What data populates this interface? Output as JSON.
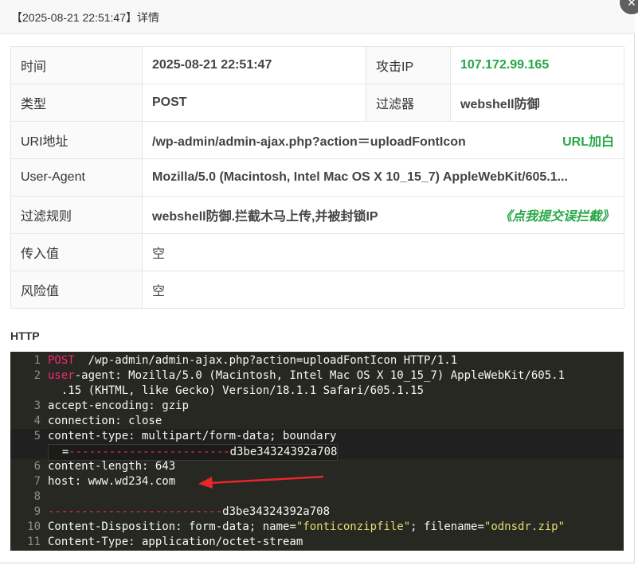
{
  "dialog": {
    "title": "【2025-08-21 22:51:47】详情",
    "close_label": "✕"
  },
  "info_table": {
    "rows": [
      {
        "label": "时间",
        "value": "2025-08-21 22:51:47",
        "label2": "攻击IP",
        "value2": "107.172.99.165"
      },
      {
        "label": "类型",
        "value": "POST",
        "label2": "过滤器",
        "value2": "webshell防御"
      },
      {
        "label": "URI地址",
        "value": "/wp-admin/admin-ajax.php?action＝uploadFontIcon",
        "action": "URL加白"
      },
      {
        "label": "User-Agent",
        "value": "Mozilla/5.0 (Macintosh, Intel Mac OS X 10_15_7) AppleWebKit/605.1..."
      },
      {
        "label": "过滤规则",
        "value": "webshell防御.拦截木马上传,并被封锁IP",
        "action": "《点我提交误拦截》"
      },
      {
        "label": "传入值",
        "value": "空"
      },
      {
        "label": "风险值",
        "value": "空"
      }
    ]
  },
  "http": {
    "label": "HTTP",
    "lines": [
      {
        "n": "1",
        "parts": [
          [
            "kw",
            "POST"
          ],
          [
            "",
            "  /wp-admin/admin-ajax.php?action=uploadFontIcon HTTP/1.1"
          ]
        ]
      },
      {
        "n": "2",
        "parts": [
          [
            "kw",
            "user"
          ],
          [
            "",
            "-agent: Mozilla/5.0 (Macintosh, Intel Mac OS X 10_15_7) AppleWebKit/605.1"
          ]
        ]
      },
      {
        "n": "",
        "parts": [
          [
            "",
            "  .15 (KHTML, like Gecko) Version/18.1.1 Safari/605.1.15"
          ]
        ]
      },
      {
        "n": "3",
        "parts": [
          [
            "",
            "accept-encoding: gzip"
          ]
        ]
      },
      {
        "n": "4",
        "parts": [
          [
            "",
            "connection: close"
          ]
        ]
      },
      {
        "n": "5",
        "parts": [
          [
            "",
            "content-type: multipart/form-data; boundary"
          ]
        ]
      },
      {
        "n": "",
        "parts": [
          [
            "",
            "  ="
          ],
          [
            "kw",
            "------------------------"
          ],
          [
            "",
            "d3be34324392a708"
          ]
        ]
      },
      {
        "n": "6",
        "parts": [
          [
            "",
            "content-length: 643"
          ]
        ]
      },
      {
        "n": "7",
        "parts": [
          [
            "",
            "host: www.wd234.com"
          ]
        ]
      },
      {
        "n": "8",
        "parts": [
          [
            "",
            ""
          ]
        ]
      },
      {
        "n": "9",
        "parts": [
          [
            "kw",
            "--------------------------"
          ],
          [
            "",
            "d3be34324392a708"
          ]
        ]
      },
      {
        "n": "10",
        "parts": [
          [
            "",
            "Content-Disposition: form-data; name="
          ],
          [
            "str",
            "\"fonticonzipfile\""
          ],
          [
            "",
            "; filename="
          ],
          [
            "str",
            "\"odnsdr.zip\""
          ]
        ]
      },
      {
        "n": "11",
        "parts": [
          [
            "",
            "Content-Type: application/octet-stream"
          ]
        ]
      }
    ]
  },
  "annotation_color": "#e8262b"
}
